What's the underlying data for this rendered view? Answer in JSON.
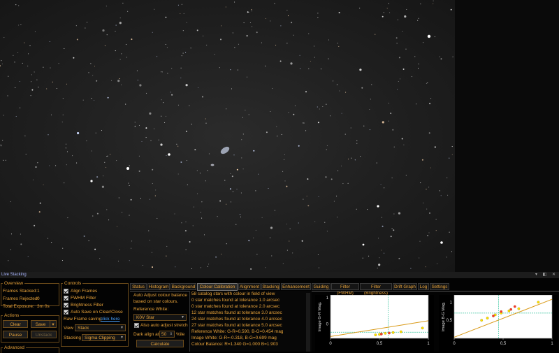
{
  "window_title": "Live Stacking",
  "window_controls": "▾ ◧ ✕",
  "overview": {
    "legend": "Overview",
    "frames_stacked_label": "Frames Stacked:",
    "frames_stacked_value": "1",
    "frames_rejected_label": "Frames Rejected:",
    "frames_rejected_value": "0",
    "total_exposure_label": "Total Exposure:",
    "total_exposure_value": "3m 0s"
  },
  "actions": {
    "legend": "Actions",
    "clear": "Clear",
    "save": "Save",
    "save_arrow": "▾",
    "pause": "Pause",
    "unstack": "Unstack"
  },
  "controls": {
    "legend": "Controls",
    "align_frames": "Align Frames",
    "fwhm_filter": "FWHM Filter",
    "brightness_filter": "Brightness Filter",
    "auto_save": "Auto Save on Clear/Close",
    "raw_frame_saving": "Raw Frame saving",
    "click_here": "click here",
    "view_label": "View",
    "view_value": "Stack",
    "stacking_label": "Stacking",
    "stacking_value": "Sigma Clipping"
  },
  "advanced_legend": "Advanced",
  "tabs": [
    "Status",
    "Histogram",
    "Background",
    "Colour Calibration",
    "Alignment",
    "Stacking",
    "Enhancement",
    "Guiding",
    "Filter (FWHM)",
    "Filter (Brightness)",
    "Drift Graph",
    "Log",
    "Settings"
  ],
  "active_tab": "Colour Calibration",
  "calibration": {
    "desc1": "Auto Adjust colour balance",
    "desc2": "based on star colours.",
    "ref_white_label": "Reference White:",
    "ref_white_value": "K0V Star",
    "also_auto": "Also auto adjust stretch",
    "dark_align_label": "Dark align at",
    "dark_align_value": "50",
    "dark_align_unit": "%ile",
    "calculate": "Calculate"
  },
  "log_lines": [
    "58 catalog stars with colour in field of view",
    "0 star matches found at tolerance 1.0 arcsec",
    "0 star matches found at tolerance 2.0 arcsec",
    "12 star matches found at tolerance 3.0 arcsec",
    "24 star matches found at tolerance 4.0 arcsec",
    "27 star matches found at tolerance 5.0 arcsec",
    "Reference White:    G-R=0.590, B-G=0.454 mag",
    "Image White:      G-R=-0.318, B-G=0.699 mag",
    "Colour Balance:    R=1.340 G=1.000 B=1.903"
  ],
  "chart_data": [
    {
      "type": "scatter",
      "ylabel": "Image G-R Mag.",
      "x_ticks": [
        "0",
        "0,5",
        "1"
      ],
      "y_ticks": [
        "1",
        "0"
      ],
      "xlim": [
        0,
        1
      ],
      "ylim": [
        -0.55,
        1.1
      ],
      "ref_x": 0.59,
      "ref_y": -0.318,
      "fit_line": {
        "x0": 0,
        "y0": -0.48,
        "x1": 1,
        "y1": 0.12
      },
      "series": [
        {
          "color": "#ffe400",
          "x": [
            0.46,
            0.5,
            0.52,
            0.56,
            0.64,
            0.72,
            0.94
          ],
          "y": [
            -0.42,
            -0.4,
            -0.38,
            -0.36,
            -0.33,
            -0.3,
            -0.16
          ]
        },
        {
          "color": "#ff3030",
          "x": [
            0.52,
            0.6
          ],
          "y": [
            -0.39,
            -0.35
          ]
        }
      ]
    },
    {
      "type": "scatter",
      "ylabel": "Image B-G Mag.",
      "x_ticks": [
        "0",
        "0,5",
        "1"
      ],
      "y_ticks": [
        "1",
        "0,5"
      ],
      "xlim": [
        0,
        1
      ],
      "ylim": [
        0,
        1.2
      ],
      "ref_x": 0.454,
      "ref_y": 0.699,
      "fit_line": {
        "x0": 0,
        "y0": 0.03,
        "x1": 1,
        "y1": 1.08
      },
      "series": [
        {
          "color": "#ffe400",
          "x": [
            0.28,
            0.34,
            0.42,
            0.48,
            0.56,
            0.66,
            0.86
          ],
          "y": [
            0.5,
            0.56,
            0.65,
            0.7,
            0.76,
            0.82,
            1.0
          ]
        },
        {
          "color": "#ff3030",
          "x": [
            0.4,
            0.48,
            0.58,
            0.62
          ],
          "y": [
            0.62,
            0.74,
            0.8,
            0.88
          ]
        }
      ]
    }
  ]
}
